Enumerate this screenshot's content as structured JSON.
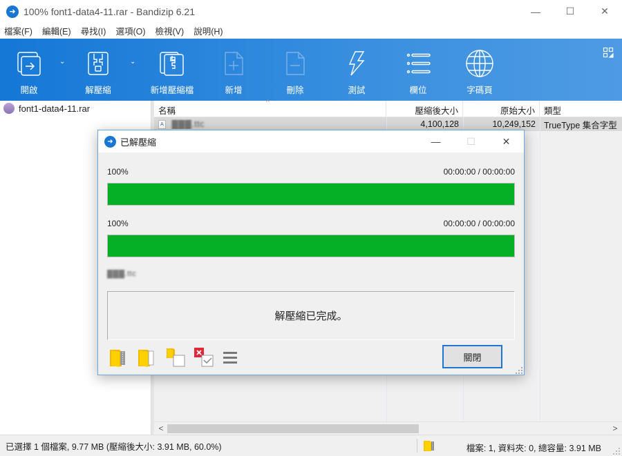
{
  "window": {
    "title": "100% font1-data4-11.rar - Bandizip 6.21",
    "controls": {
      "minimize": "—",
      "maximize": "☐",
      "close": "✕"
    }
  },
  "menu": [
    "檔案(F)",
    "編輯(E)",
    "尋找(I)",
    "選項(O)",
    "檢視(V)",
    "說明(H)"
  ],
  "toolbar": {
    "buttons": [
      {
        "label": "開啟",
        "icon": "open-icon",
        "enabled": true,
        "has_dropdown": true
      },
      {
        "label": "解壓縮",
        "icon": "extract-icon",
        "enabled": true,
        "has_dropdown": true
      },
      {
        "label": "新增壓縮檔",
        "icon": "new-archive-icon",
        "enabled": true,
        "has_dropdown": false
      },
      {
        "label": "新增",
        "icon": "add-file-icon",
        "enabled": false,
        "has_dropdown": false
      },
      {
        "label": "刪除",
        "icon": "delete-file-icon",
        "enabled": false,
        "has_dropdown": false
      },
      {
        "label": "測試",
        "icon": "lightning-icon",
        "enabled": true,
        "has_dropdown": false
      },
      {
        "label": "欄位",
        "icon": "list-icon",
        "enabled": true,
        "has_dropdown": false
      },
      {
        "label": "字碼頁",
        "icon": "globe-icon",
        "enabled": true,
        "has_dropdown": false
      }
    ],
    "dropdown_glyph": "⌄"
  },
  "tree": {
    "archive_name": "font1-data4-11.rar"
  },
  "file_list": {
    "columns": [
      "名稱",
      "壓縮後大小",
      "原始大小",
      "類型"
    ],
    "rows": [
      {
        "name": "▓▓▓.ttc",
        "packed": "4,100,128",
        "size": "10,249,152",
        "type": "TrueType 集合字型"
      }
    ]
  },
  "scroll": {
    "left": "<",
    "right": ">"
  },
  "status": {
    "left": "已選擇 1 個檔案, 9.77 MB (壓縮後大小: 3.91 MB, 60.0%)",
    "right": "檔案: 1, 資料夾: 0, 總容量: 3.91 MB"
  },
  "dialog": {
    "title": "已解壓縮",
    "progress": [
      {
        "percent_label": "100%",
        "time": "00:00:00 / 00:00:00",
        "value": 100
      },
      {
        "percent_label": "100%",
        "time": "00:00:00 / 00:00:00",
        "value": 100
      }
    ],
    "current_file": "▓▓▓.ttc",
    "message": "解壓縮已完成。",
    "close_label": "關閉",
    "progress_color": "#06b025"
  }
}
